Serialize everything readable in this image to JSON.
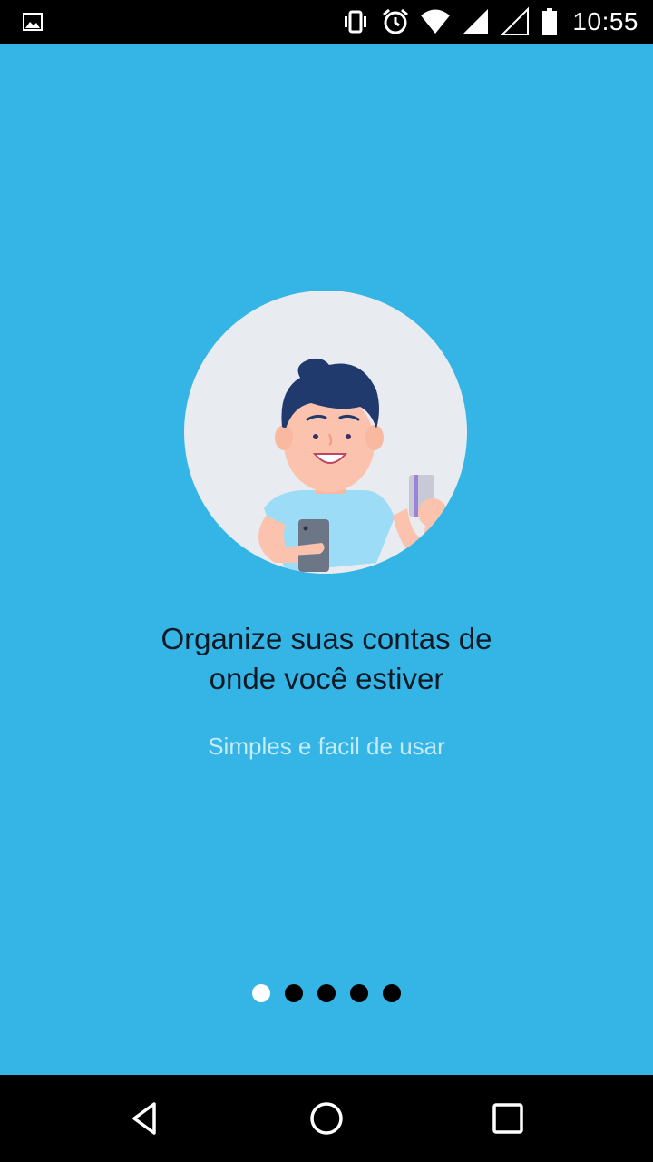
{
  "status_bar": {
    "time": "10:55",
    "icons": [
      "image-notification-icon",
      "vibrate-icon",
      "alarm-icon",
      "wifi-icon",
      "signal-icon",
      "signal-empty-icon",
      "battery-icon"
    ]
  },
  "onboarding": {
    "headline": "Organize suas contas de\nonde você estiver",
    "subtitle": "Simples e facil de usar",
    "illustration": "person-with-phone-and-card-illustration",
    "pager": {
      "total": 5,
      "current": 1
    }
  },
  "nav_bar": {
    "icons": [
      "back-icon",
      "home-icon",
      "recents-icon"
    ]
  },
  "colors": {
    "background": "#34b5e6",
    "headline": "#0d1a26",
    "subtitle": "#c5ebf8",
    "dot_active": "#ffffff",
    "dot_inactive": "#000000"
  }
}
